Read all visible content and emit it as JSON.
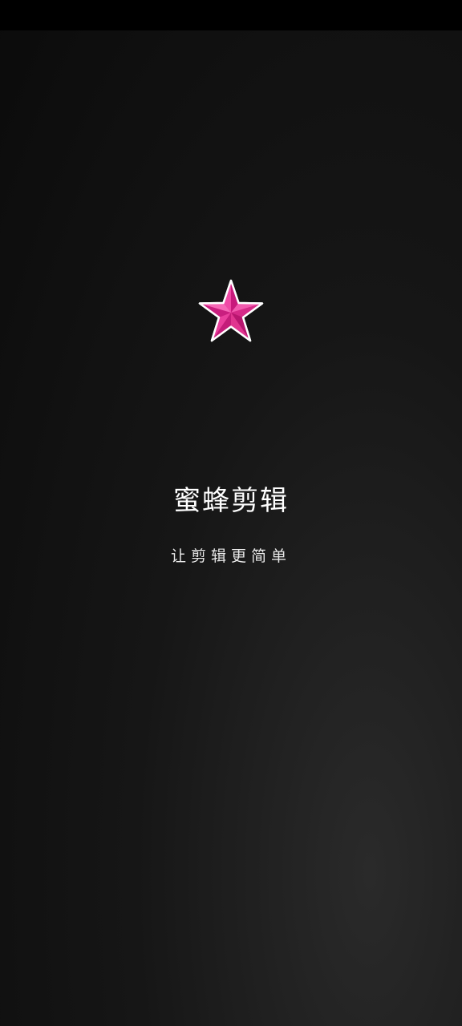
{
  "splash": {
    "app_name": "蜜蜂剪辑",
    "slogan": "让剪辑更简单"
  },
  "logo": {
    "icon": "star-icon",
    "color": "#e0268f",
    "outline": "#ffffff"
  },
  "colors": {
    "background": "#111111",
    "status_bar": "#000000"
  }
}
